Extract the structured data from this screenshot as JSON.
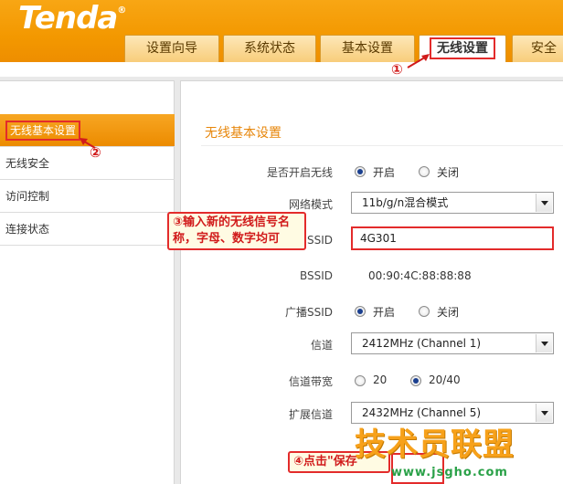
{
  "brand": {
    "logo": "Tenda",
    "trademark": "®"
  },
  "tabs": [
    {
      "label": "设置向导"
    },
    {
      "label": "系统状态"
    },
    {
      "label": "基本设置"
    },
    {
      "label": "无线设置"
    },
    {
      "label": "安全"
    }
  ],
  "sidebar": {
    "items": [
      {
        "label": "无线基本设置"
      },
      {
        "label": "无线安全"
      },
      {
        "label": "访问控制"
      },
      {
        "label": "连接状态"
      }
    ]
  },
  "form": {
    "title": "无线基本设置",
    "enable_wireless": {
      "label": "是否开启无线",
      "on": "开启",
      "off": "关闭",
      "selected": "on"
    },
    "network_mode": {
      "label": "网络模式",
      "value": "11b/g/n混合模式"
    },
    "ssid": {
      "label": "SSID",
      "value": "4G301"
    },
    "bssid": {
      "label": "BSSID",
      "value": "00:90:4C:88:88:88"
    },
    "broadcast_ssid": {
      "label": "广播SSID",
      "on": "开启",
      "off": "关闭",
      "selected": "on"
    },
    "channel": {
      "label": "信道",
      "value": "2412MHz (Channel 1)"
    },
    "bandwidth": {
      "label": "信道带宽",
      "opt1": "20",
      "opt2": "20/40",
      "selected": "20/40"
    },
    "ext_channel": {
      "label": "扩展信道",
      "value": "2432MHz (Channel 5)"
    }
  },
  "annotations": {
    "step1": "①",
    "step2": "②",
    "step3_line1": "③输入新的无线信号名",
    "step3_line2": "称，字母、数字均可",
    "step4": "④点击\"保存\""
  },
  "watermark": {
    "title": "技术员联盟",
    "url": "www.jsgho.com"
  },
  "colors": {
    "header": "#f39800",
    "accent": "#e7860a",
    "annotation": "#e32b2b"
  }
}
